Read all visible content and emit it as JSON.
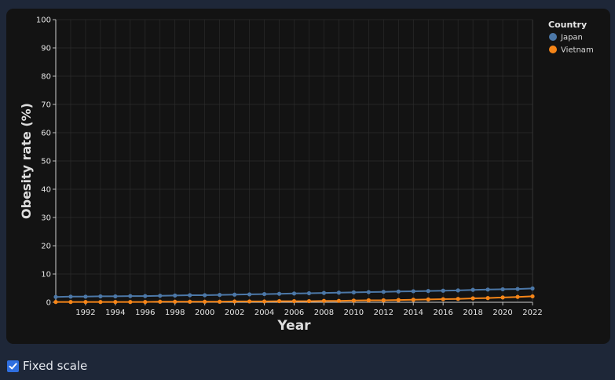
{
  "chart_data": {
    "type": "line",
    "xlabel": "Year",
    "ylabel": "Obesity rate (%)",
    "xlim": [
      1990,
      2022
    ],
    "ylim": [
      0,
      100
    ],
    "x_ticks": [
      1992,
      1994,
      1996,
      1998,
      2000,
      2002,
      2004,
      2006,
      2008,
      2010,
      2012,
      2014,
      2016,
      2018,
      2020,
      2022
    ],
    "y_ticks": [
      0,
      10,
      20,
      30,
      40,
      50,
      60,
      70,
      80,
      90,
      100
    ],
    "grid": true,
    "legend": {
      "title": "Country",
      "position": "top-right"
    },
    "x": [
      1990,
      1991,
      1992,
      1993,
      1994,
      1995,
      1996,
      1997,
      1998,
      1999,
      2000,
      2001,
      2002,
      2003,
      2004,
      2005,
      2006,
      2007,
      2008,
      2009,
      2010,
      2011,
      2012,
      2013,
      2014,
      2015,
      2016,
      2017,
      2018,
      2019,
      2020,
      2021,
      2022
    ],
    "series": [
      {
        "name": "Japan",
        "color": "#4c78a8",
        "values": [
          1.9,
          2.0,
          2.0,
          2.1,
          2.1,
          2.2,
          2.2,
          2.3,
          2.4,
          2.5,
          2.5,
          2.6,
          2.7,
          2.8,
          2.9,
          3.0,
          3.1,
          3.2,
          3.3,
          3.4,
          3.5,
          3.6,
          3.7,
          3.8,
          3.9,
          4.0,
          4.1,
          4.2,
          4.4,
          4.5,
          4.6,
          4.7,
          4.9
        ]
      },
      {
        "name": "Vietnam",
        "color": "#f58518",
        "values": [
          0.1,
          0.1,
          0.1,
          0.1,
          0.1,
          0.1,
          0.1,
          0.2,
          0.2,
          0.2,
          0.2,
          0.2,
          0.3,
          0.3,
          0.3,
          0.4,
          0.4,
          0.4,
          0.5,
          0.5,
          0.6,
          0.7,
          0.7,
          0.8,
          0.9,
          1.0,
          1.1,
          1.2,
          1.4,
          1.5,
          1.7,
          1.9,
          2.1
        ]
      }
    ]
  },
  "controls": {
    "fixed_scale_label": "Fixed scale",
    "fixed_scale_checked": true
  },
  "colors": {
    "page_bg": "#1e2738",
    "chart_bg": "#131313",
    "checkbox_accent": "#2f6fe0"
  }
}
